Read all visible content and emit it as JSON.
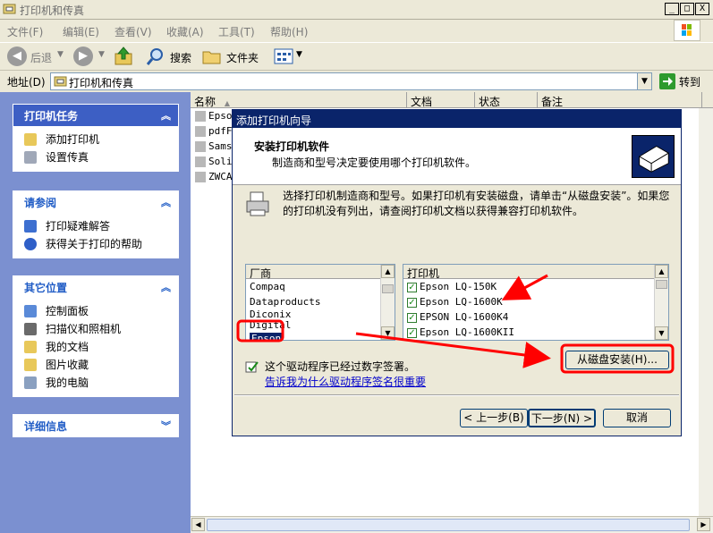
{
  "window": {
    "title": "打印机和传真",
    "caption_buttons": [
      "_",
      "□",
      "X"
    ]
  },
  "menu": [
    "文件(F)",
    "编辑(E)",
    "查看(V)",
    "收藏(A)",
    "工具(T)",
    "帮助(H)"
  ],
  "toolbar": {
    "back_label": "后退",
    "search_label": "搜索",
    "folders_label": "文件夹"
  },
  "address": {
    "label": "地址(D)",
    "value": "打印机和传真",
    "go_label": "转到"
  },
  "left_pane": {
    "printer_tasks": {
      "title": "打印机任务",
      "items": [
        "添加打印机",
        "设置传真"
      ]
    },
    "see_also": {
      "title": "请参阅",
      "items": [
        "打印疑难解答",
        "获得关于打印的帮助"
      ]
    },
    "other_places": {
      "title": "其它位置",
      "items": [
        "控制面板",
        "扫描仪和照相机",
        "我的文档",
        "图片收藏",
        "我的电脑"
      ]
    },
    "details": {
      "title": "详细信息"
    }
  },
  "list": {
    "columns": [
      "名称",
      "文档",
      "状态",
      "备注"
    ],
    "rows": [
      "Epsor",
      "pdfF",
      "Sams",
      "Soli",
      "ZWCAI"
    ]
  },
  "wizard": {
    "title": "添加打印机向导",
    "heading": "安装打印机软件",
    "subheading": "制造商和型号决定要使用哪个打印机软件。",
    "instruction": "选择打印机制造商和型号。如果打印机有安装磁盘，请单击“从磁盘安装”。如果您的打印机没有列出，请查阅打印机文档以获得兼容打印机软件。",
    "manufacturer_header": "厂商",
    "manufacturers": [
      "Compaq",
      "Dataproducts",
      "Diconix",
      "Digital",
      "Epson"
    ],
    "selected_manufacturer": "Epson",
    "printer_header": "打印机",
    "printers": [
      "Epson LQ-150K",
      "Epson LQ-1600K",
      "EPSON LQ-1600K4",
      "Epson LQ-1600KII"
    ],
    "have_disk_label": "从磁盘安装(H)...",
    "signed_text": "这个驱动程序已经过数字签署。",
    "signed_link": "告诉我为什么驱动程序签名很重要",
    "back_button": "< 上一步(B)",
    "next_button": "下一步(N) >",
    "cancel_button": "取消"
  },
  "colors": {
    "title_blue": "#0a246a",
    "task_pane_bg": "#7b90d0",
    "panel_header_text": "#215dc6",
    "annotation_red": "#ff0000"
  }
}
